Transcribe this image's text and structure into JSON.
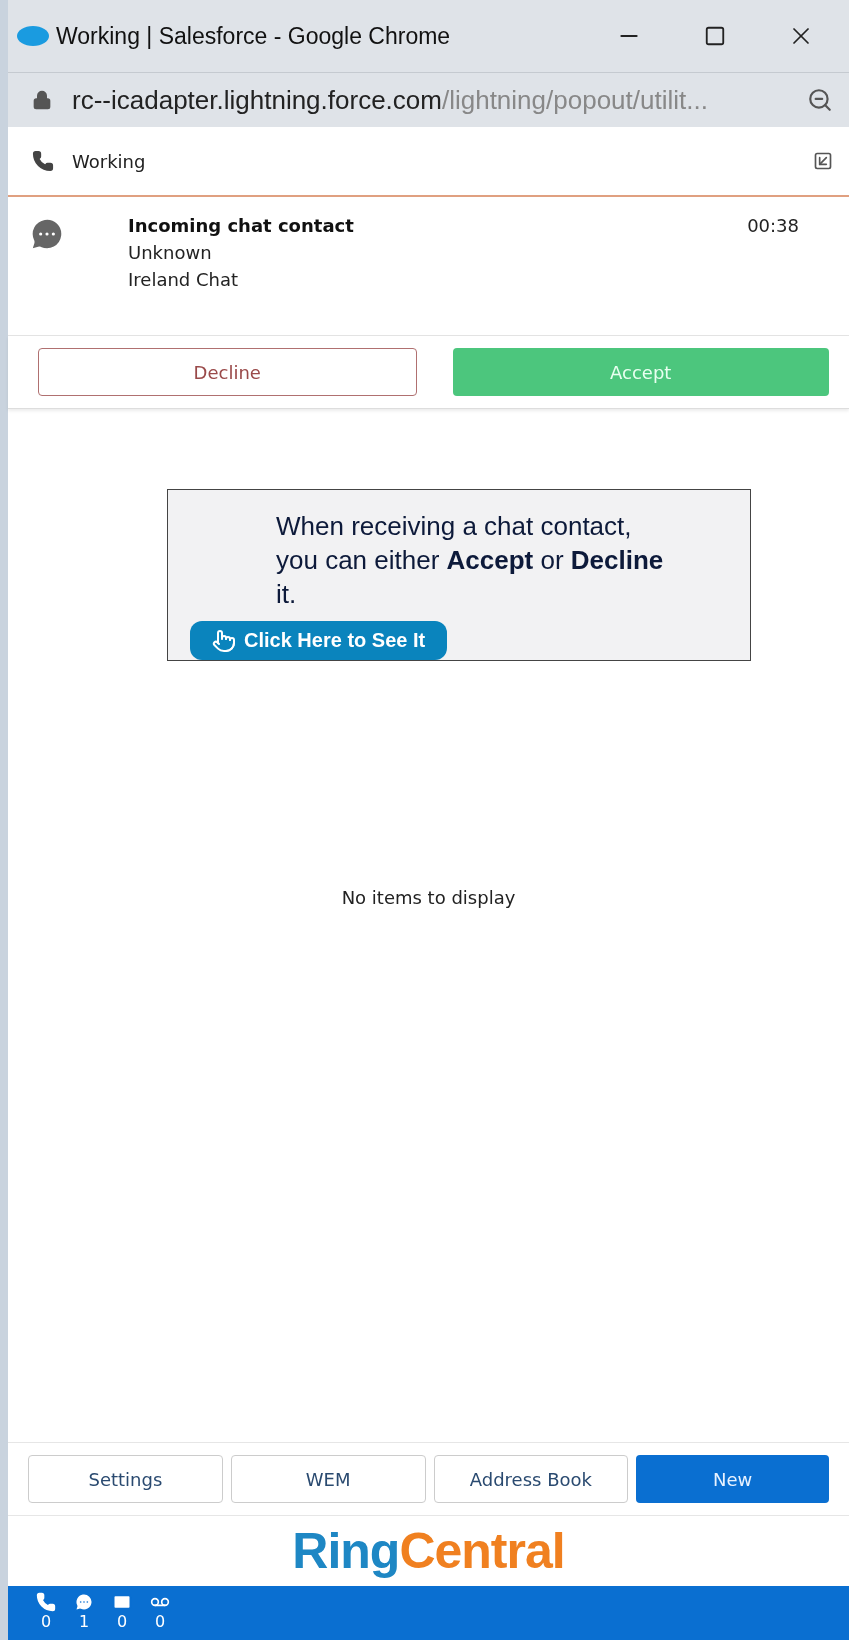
{
  "window": {
    "title": "Working | Salesforce - Google Chrome"
  },
  "address_bar": {
    "host": "rc--icadapter.lightning.force.com",
    "path": "/lightning/popout/utilit..."
  },
  "header": {
    "status": "Working"
  },
  "contact": {
    "title": "Incoming chat contact",
    "caller": "Unknown",
    "queue": "Ireland Chat",
    "timer": "00:38"
  },
  "actions": [
    {
      "label": "Decline",
      "kind": "outline"
    },
    {
      "label": "Accept",
      "kind": "primary"
    }
  ],
  "callout": {
    "text": "When receiving a chat contact, you can either **Accept** or **Decline** it.",
    "button": "Click Here to See It"
  },
  "empty_message": "No items to display",
  "toolbar": [
    {
      "label": "Settings",
      "selected": false
    },
    {
      "label": "WEM",
      "selected": false
    },
    {
      "label": "Address Book",
      "selected": false
    },
    {
      "label": "New",
      "selected": true
    }
  ],
  "logo": [
    "Ring",
    "Central"
  ],
  "counters": [
    {
      "kind": "phone",
      "count": "0"
    },
    {
      "kind": "chat",
      "count": "1"
    },
    {
      "kind": "email",
      "count": "0"
    },
    {
      "kind": "voicemail",
      "count": "0"
    }
  ]
}
